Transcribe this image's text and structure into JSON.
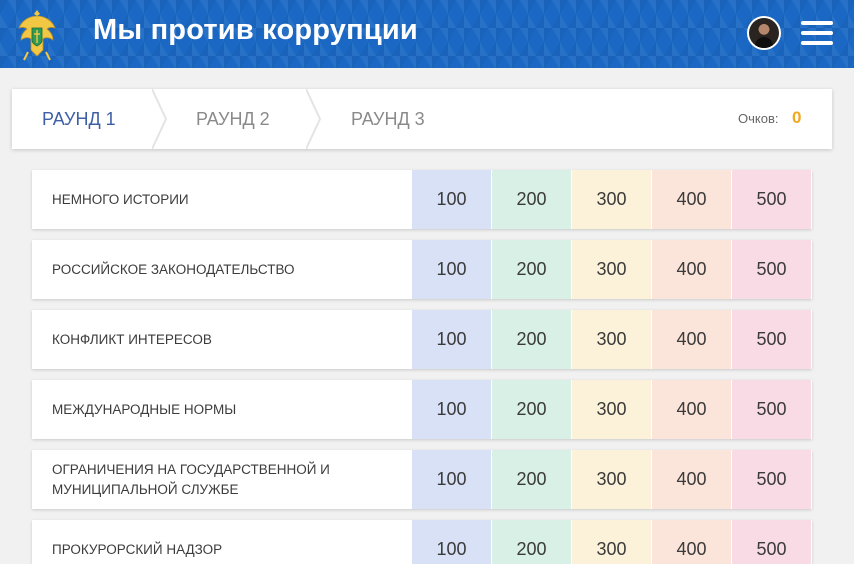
{
  "header": {
    "title": "Мы против коррупции",
    "emblem_icon": "double-headed-eagle-emblem",
    "avatar_icon": "user-avatar",
    "menu_icon": "hamburger-menu-icon",
    "colors": {
      "background": "#1a68c4",
      "text": "#ffffff"
    }
  },
  "rounds": {
    "tabs": [
      {
        "label": "РАУНД 1",
        "active": true
      },
      {
        "label": "РАУНД 2",
        "active": false
      },
      {
        "label": "РАУНД 3",
        "active": false
      }
    ],
    "score_label": "Очков:",
    "score_value": "0",
    "colors": {
      "active": "#3e5fa6",
      "inactive": "#8a8a8a",
      "score": "#f0a81e"
    }
  },
  "board": {
    "cell_colors": [
      "#d9e1f7",
      "#d8f0e5",
      "#fcf2da",
      "#fbe5da",
      "#f9dbe5"
    ],
    "rows": [
      {
        "category": "НЕМНОГО ИСТОРИИ",
        "values": [
          "100",
          "200",
          "300",
          "400",
          "500"
        ]
      },
      {
        "category": "РОССИЙСКОЕ ЗАКОНОДАТЕЛЬСТВО",
        "values": [
          "100",
          "200",
          "300",
          "400",
          "500"
        ]
      },
      {
        "category": "КОНФЛИКТ ИНТЕРЕСОВ",
        "values": [
          "100",
          "200",
          "300",
          "400",
          "500"
        ]
      },
      {
        "category": "МЕЖДУНАРОДНЫЕ НОРМЫ",
        "values": [
          "100",
          "200",
          "300",
          "400",
          "500"
        ]
      },
      {
        "category": "ОГРАНИЧЕНИЯ НА ГОСУДАРСТВЕННОЙ И МУНИЦИПАЛЬНОЙ СЛУЖБЕ",
        "values": [
          "100",
          "200",
          "300",
          "400",
          "500"
        ]
      },
      {
        "category": "ПРОКУРОРСКИЙ НАДЗОР",
        "values": [
          "100",
          "200",
          "300",
          "400",
          "500"
        ]
      }
    ]
  }
}
